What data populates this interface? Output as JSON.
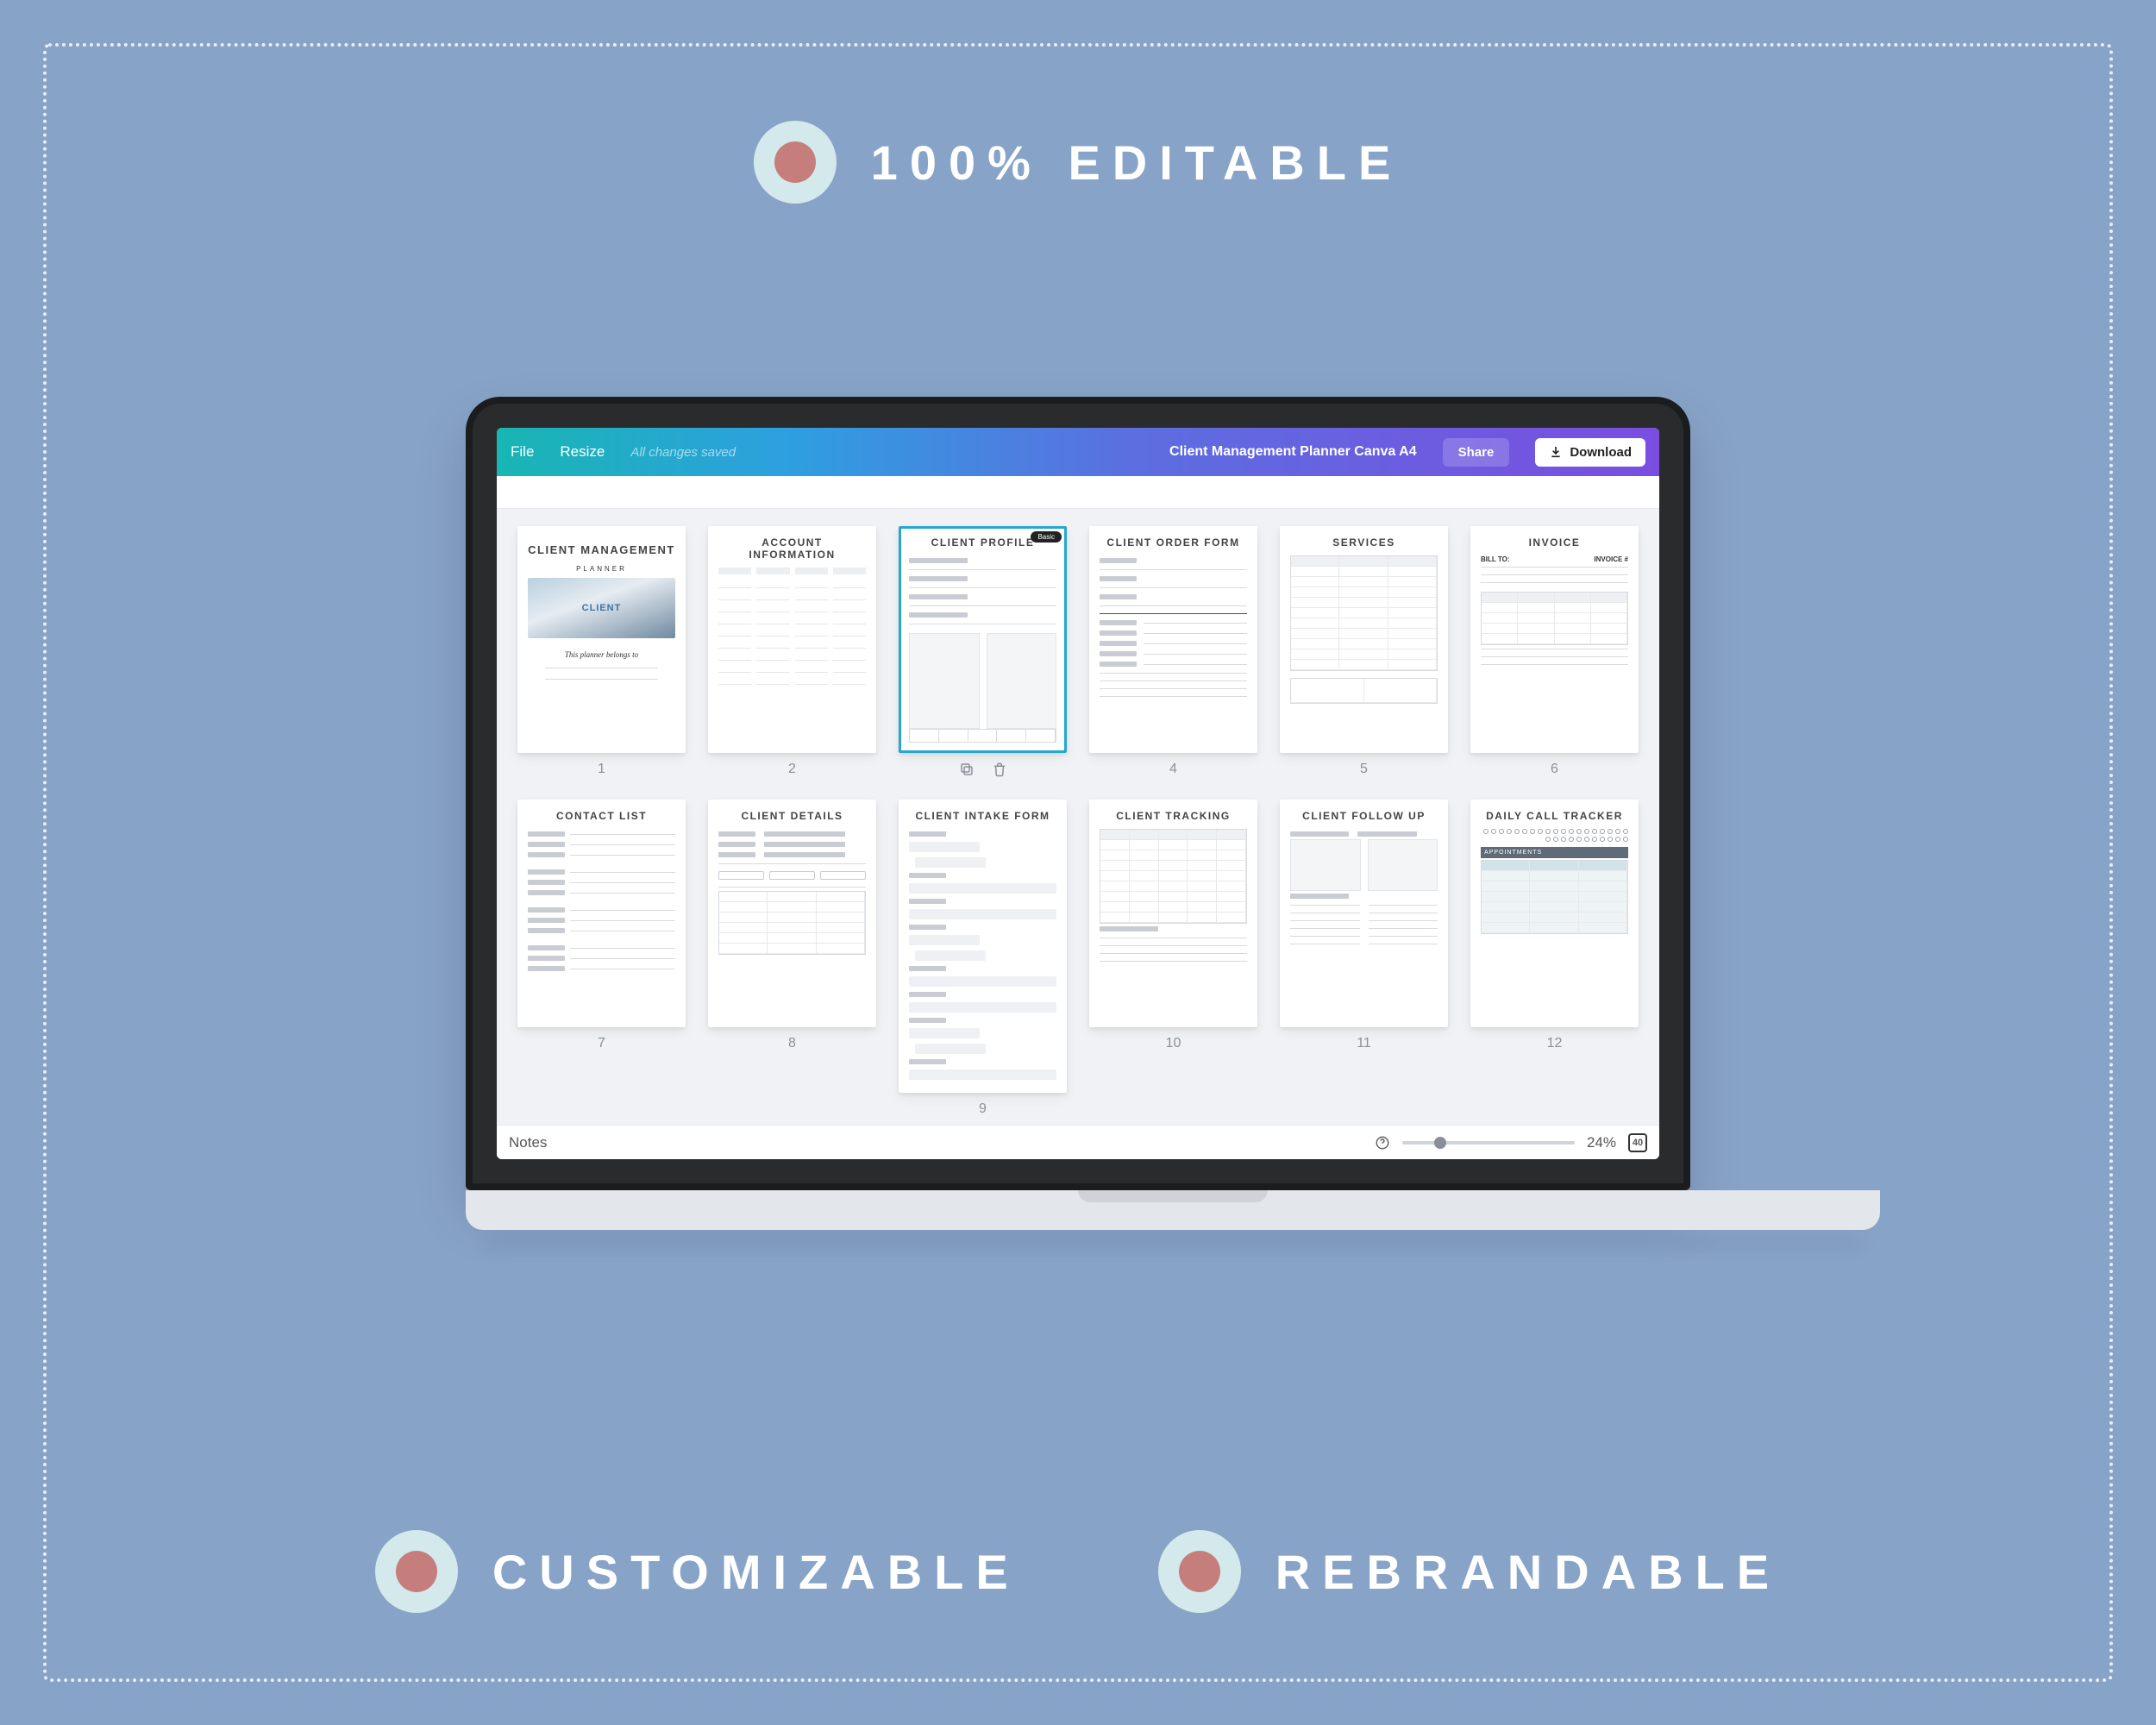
{
  "hero": {
    "top": "100% EDITABLE",
    "bottom_left": "CUSTOMIZABLE",
    "bottom_right": "REBRANDABLE"
  },
  "editor": {
    "menu": {
      "file": "File",
      "resize": "Resize"
    },
    "status": "All changes saved",
    "document_title": "Client Management Planner Canva A4",
    "share": "Share",
    "download": "Download",
    "notes": "Notes",
    "zoom": "24%",
    "grid_count": "40"
  },
  "pages": [
    {
      "n": "1",
      "title": "CLIENT MANAGEMENT",
      "selected": false,
      "kind": "cover",
      "sub": "PLANNER",
      "caption": "This planner belongs to",
      "badge": "CLIENT"
    },
    {
      "n": "2",
      "title": "ACCOUNT INFORMATION",
      "kind": "table4"
    },
    {
      "n": "3",
      "title": "CLIENT PROFILE",
      "kind": "profile",
      "selected": true,
      "badge": "Basic"
    },
    {
      "n": "4",
      "title": "CLIENT ORDER FORM",
      "kind": "order"
    },
    {
      "n": "5",
      "title": "SERVICES",
      "kind": "services"
    },
    {
      "n": "6",
      "title": "INVOICE",
      "kind": "invoice",
      "left": "BILL TO:",
      "right": "INVOICE #"
    },
    {
      "n": "7",
      "title": "CONTACT LIST",
      "kind": "contacts"
    },
    {
      "n": "8",
      "title": "CLIENT DETAILS",
      "kind": "details"
    },
    {
      "n": "9",
      "title": "CLIENT INTAKE FORM",
      "kind": "intake"
    },
    {
      "n": "10",
      "title": "CLIENT TRACKING",
      "kind": "tracking"
    },
    {
      "n": "11",
      "title": "CLIENT FOLLOW UP",
      "kind": "followup"
    },
    {
      "n": "12",
      "title": "DAILY CALL TRACKER",
      "kind": "calltracker",
      "section": "APPOINTMENTS"
    }
  ]
}
